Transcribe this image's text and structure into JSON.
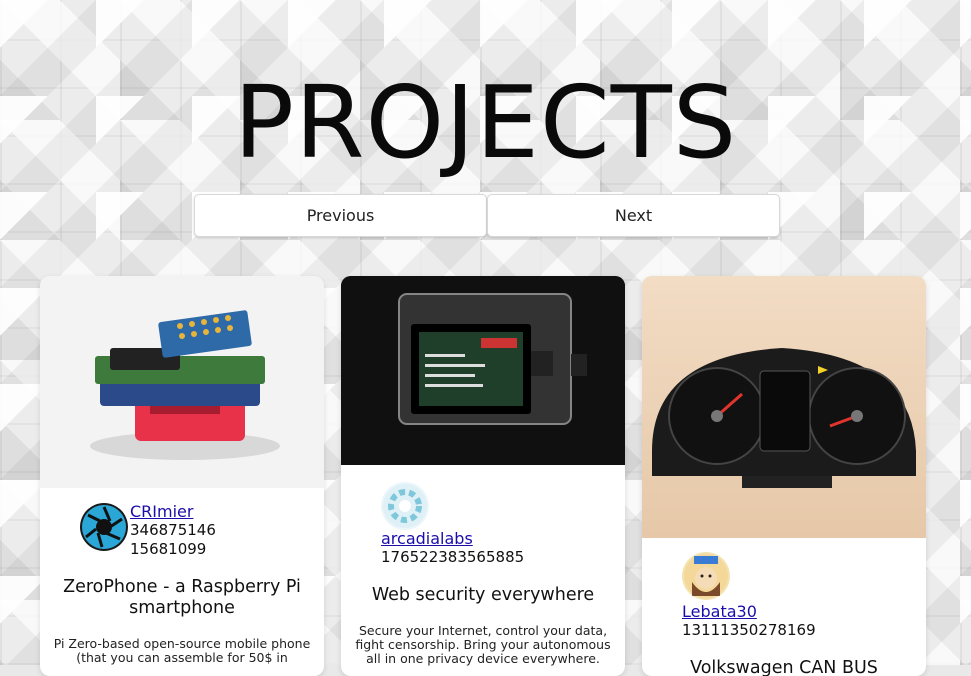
{
  "page": {
    "title": "PROJECTS"
  },
  "pager": {
    "previous": "Previous",
    "next": "Next"
  },
  "cards": [
    {
      "author": "CRImier",
      "numbers": [
        "346875146",
        "15681099"
      ],
      "title": "ZeroPhone - a Raspberry Pi smartphone",
      "description": "Pi Zero-based open-source mobile phone (that you can assemble for 50$ in"
    },
    {
      "author": "arcadialabs",
      "numbers": [
        "176522383565885"
      ],
      "title": "Web security everywhere",
      "description": "Secure your Internet, control your data, fight censorship. Bring your autonomous all in one privacy device everywhere."
    },
    {
      "author": "Lebata30",
      "numbers": [
        "13111350278169"
      ],
      "title": "Volkswagen CAN BUS",
      "description": ""
    }
  ],
  "colors": {
    "link": "#1a0dab",
    "accent_red": "#e0342c"
  }
}
